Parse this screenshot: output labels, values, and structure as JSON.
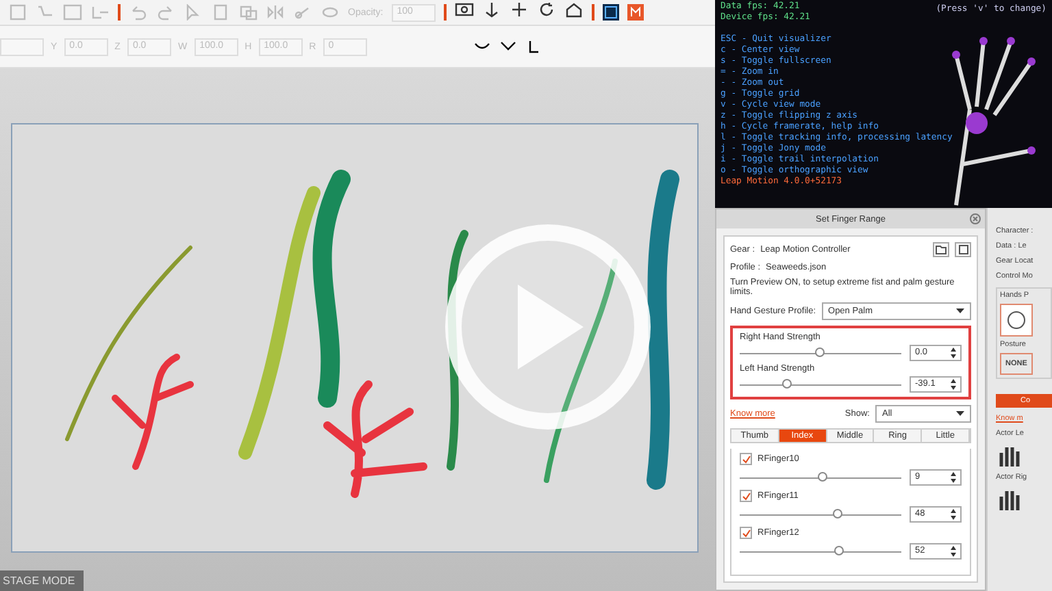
{
  "toolbar": {
    "opacity_label": "Opacity:",
    "opacity_value": "100",
    "disabled": true
  },
  "transform_fields": [
    {
      "label": "Y",
      "value": "0.0",
      "disabled": true
    },
    {
      "label": "Z",
      "value": "0.0",
      "disabled": true
    },
    {
      "label": "W",
      "value": "100.0",
      "disabled": true
    },
    {
      "label": "H",
      "value": "100.0",
      "disabled": true
    },
    {
      "label": "R",
      "value": "0",
      "disabled": true
    }
  ],
  "visualizer": {
    "stats": [
      "Data fps: 42.21",
      "Device fps: 42.21"
    ],
    "hint": "(Press 'v' to change)",
    "help": [
      "ESC - Quit visualizer",
      "c - Center view",
      "s - Toggle fullscreen",
      "= - Zoom in",
      "- - Zoom out",
      "g - Toggle grid",
      "v - Cycle view mode",
      "z - Toggle flipping z axis",
      "h - Cycle framerate, help info",
      "l - Toggle tracking info, processing latency",
      "j - Toggle Jony mode",
      "i - Toggle trail interpolation",
      "o - Toggle orthographic view"
    ],
    "version": "Leap Motion 4.0.0+52173"
  },
  "stage": {
    "mode_label": "STAGE MODE"
  },
  "dialog": {
    "title": "Set Finger Range",
    "gear_label": "Gear :",
    "gear": "Leap Motion Controller",
    "profile_label": "Profile :",
    "profile": "Seaweeds.json",
    "instruction": "Turn Preview ON, to setup extreme fist and palm gesture limits.",
    "gesture_label": "Hand Gesture Profile:",
    "gesture_value": "Open Palm",
    "strengths": [
      {
        "label": "Right Hand Strength",
        "level": 0.5,
        "value": "0.0"
      },
      {
        "label": "Left Hand Strength",
        "level": 0.3,
        "value": "-39.1"
      }
    ],
    "know_more": "Know more",
    "show_label": "Show:",
    "show_value": "All",
    "tabs": [
      {
        "label": "Thumb",
        "selected": false
      },
      {
        "label": "Index",
        "selected": true
      },
      {
        "label": "Middle",
        "selected": false
      },
      {
        "label": "Ring",
        "selected": false
      },
      {
        "label": "Little",
        "selected": false
      }
    ],
    "fingers": [
      {
        "name": "RFinger10",
        "checked": true,
        "level": 0.52,
        "value": "9"
      },
      {
        "name": "RFinger11",
        "checked": true,
        "level": 0.61,
        "value": "48"
      },
      {
        "name": "RFinger12",
        "checked": true,
        "level": 0.62,
        "value": "52"
      }
    ]
  },
  "side_panel": {
    "labels": [
      "Character :",
      "Data :  Le",
      "Gear Locat",
      "Control Mo"
    ],
    "group_title": "Hands P",
    "posture_label": "Posture",
    "posture_value": "NONE",
    "section_button": "Co",
    "know_more": "Know m",
    "actor_labels": [
      "Actor Le",
      "Actor Rig"
    ]
  }
}
